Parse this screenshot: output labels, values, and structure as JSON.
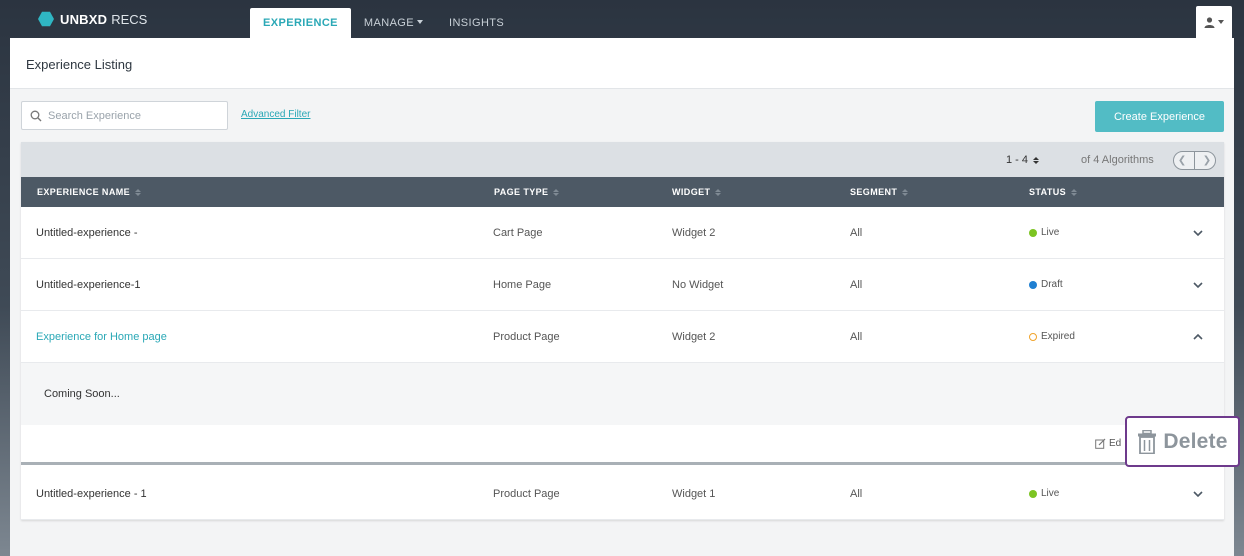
{
  "brand": {
    "name_bold": "UNBXD",
    "name_light": "RECS",
    "color": "#2fb6c3"
  },
  "nav": {
    "items": [
      {
        "label": "EXPERIENCE",
        "active": true
      },
      {
        "label": "MANAGE",
        "active": false,
        "dropdown": true
      },
      {
        "label": "INSIGHTS",
        "active": false
      }
    ]
  },
  "page": {
    "title": "Experience Listing"
  },
  "toolbar": {
    "search_placeholder": "Search Experience",
    "advanced_filter": "Advanced Filter",
    "create_label": "Create Experience"
  },
  "pagination": {
    "range": "1 - 4",
    "total": "of 4 Algorithms"
  },
  "table": {
    "headers": [
      "EXPERIENCE NAME",
      "PAGE TYPE",
      "WIDGET",
      "SEGMENT",
      "STATUS"
    ],
    "rows": [
      {
        "name": "Untitled-experience -",
        "page_type": "Cart Page",
        "widget": "Widget 2",
        "segment": "All",
        "status": "Live",
        "status_color": "#7cc422"
      },
      {
        "name": "Untitled-experience-1",
        "page_type": "Home Page",
        "widget": "No Widget",
        "segment": "All",
        "status": "Draft",
        "status_color": "#1f7fd1"
      },
      {
        "name": "Experience for Home page",
        "page_type": "Product Page",
        "widget": "Widget 2",
        "segment": "All",
        "status": "Expired",
        "status_color": "#f0a32b",
        "expanded": true
      },
      {
        "name": "Untitled-experience - 1",
        "page_type": "Product Page",
        "widget": "Widget 1",
        "segment": "All",
        "status": "Live",
        "status_color": "#7cc422"
      }
    ]
  },
  "expanded": {
    "body_text": "Coming Soon...",
    "edit_label": "Ed",
    "delete_label": "Delete"
  }
}
